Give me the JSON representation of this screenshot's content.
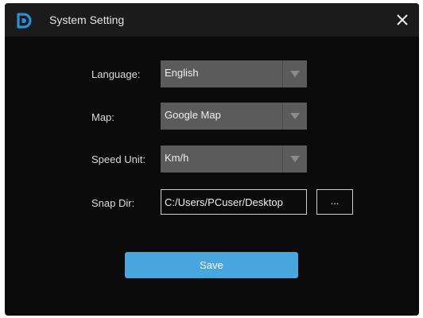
{
  "window": {
    "title": "System Setting",
    "logo_icon": "d-logo-icon",
    "close_icon": "close-icon"
  },
  "form": {
    "language": {
      "label": "Language:",
      "value": "English"
    },
    "map": {
      "label": "Map:",
      "value": "Google Map"
    },
    "speed_unit": {
      "label": "Speed Unit:",
      "value": "Km/h"
    },
    "snap_dir": {
      "label": "Snap Dir:",
      "value": "C:/Users/PCuser/Desktop",
      "browse_label": "..."
    }
  },
  "actions": {
    "save_label": "Save"
  },
  "colors": {
    "background": "#0b0b0b",
    "titlebar": "#1b1b1b",
    "select": "#5b5b5b",
    "accent": "#49a7de",
    "logo": "#2a8fd6"
  }
}
